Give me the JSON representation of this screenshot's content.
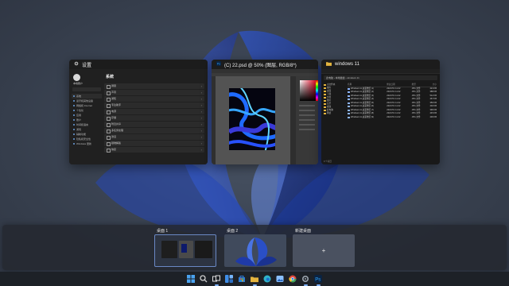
{
  "windows": [
    {
      "id": "settings",
      "title": "设置",
      "icon": "gear-icon"
    },
    {
      "id": "photoshop",
      "title": "(C) 22.psd @ 50% (图层, RGB/8*)",
      "icon": "photoshop-icon"
    },
    {
      "id": "explorer",
      "title": "windows 11",
      "icon": "folder-icon"
    }
  ],
  "settings": {
    "heading": "系统",
    "user": "本地账户",
    "nav": [
      "系统",
      "蓝牙和其他设备",
      "网络和 Internet",
      "个性化",
      "应用",
      "账户",
      "时间和语言",
      "游戏",
      "辅助功能",
      "隐私和安全性",
      "Windows 更新"
    ],
    "rows": [
      "屏幕",
      "声音",
      "通知",
      "专注助手",
      "电源",
      "存储",
      "附近共享",
      "多任务处理",
      "激活",
      "疑难解答",
      "恢复"
    ]
  },
  "explorer": {
    "address": "此电脑 › 本地磁盘 › windows 11",
    "nav": [
      "主文件夹",
      "图库",
      "桌面",
      "下载",
      "文档",
      "图片",
      "音乐",
      "视频",
      "此电脑",
      "网络"
    ],
    "columns": [
      "名称",
      "修改日期",
      "类型",
      "大小"
    ],
    "files": [
      {
        "name": "Windows 11 桌面壁纸 (1)",
        "date": "2021/7/1 11:22",
        "type": "JPG 文件",
        "size": "421 KB"
      },
      {
        "name": "Windows 11 桌面壁纸 (2)",
        "date": "2021/7/1 11:22",
        "type": "JPG 文件",
        "size": "388 KB"
      },
      {
        "name": "Windows 11 桌面壁纸 (3)",
        "date": "2021/7/1 11:22",
        "type": "JPG 文件",
        "size": "512 KB"
      },
      {
        "name": "Windows 11 桌面壁纸 (4)",
        "date": "2021/7/1 11:22",
        "type": "JPG 文件",
        "size": "467 KB"
      },
      {
        "name": "Windows 11 桌面壁纸 (5)",
        "date": "2021/7/1 11:22",
        "type": "JPG 文件",
        "size": "350 KB"
      },
      {
        "name": "Windows 11 桌面壁纸 (6)",
        "date": "2021/7/1 11:22",
        "type": "JPG 文件",
        "size": "402 KB"
      },
      {
        "name": "Windows 11 桌面壁纸 (7)",
        "date": "2021/7/1 11:22",
        "type": "JPG 文件",
        "size": "396 KB"
      },
      {
        "name": "Windows 11 桌面壁纸 (8)",
        "date": "2021/7/1 11:22",
        "type": "JPG 文件",
        "size": "445 KB"
      },
      {
        "name": "Windows 11 桌面壁纸 (9)",
        "date": "2021/7/1 11:22",
        "type": "JPG 文件",
        "size": "430 KB"
      }
    ],
    "status": "9 个项目"
  },
  "desktops": [
    {
      "label": "桌面 1",
      "active": true
    },
    {
      "label": "桌面 2",
      "active": false
    }
  ],
  "new_desktop": {
    "label": "新建桌面",
    "icon": "plus-icon",
    "symbol": "+"
  },
  "taskbar": [
    {
      "name": "start-icon",
      "color": "#4aa3f0",
      "active": false
    },
    {
      "name": "search-icon",
      "color": "#d0d0d0",
      "active": false
    },
    {
      "name": "task-view-icon",
      "color": "#e0e0e0",
      "active": true
    },
    {
      "name": "widgets-icon",
      "color": "#3f8ee8",
      "active": false
    },
    {
      "name": "store-icon",
      "color": "#2d7bd6",
      "active": false
    },
    {
      "name": "file-explorer-icon",
      "color": "#e4b43e",
      "active": true
    },
    {
      "name": "edge-icon",
      "color": "#2fb3c9",
      "active": false
    },
    {
      "name": "photos-icon",
      "color": "#8ac0ff",
      "active": false
    },
    {
      "name": "chrome-icon",
      "color": "#e0493d",
      "active": false
    },
    {
      "name": "settings-icon",
      "color": "#9aa3ad",
      "active": true
    },
    {
      "name": "photoshop-icon",
      "color": "#2f79c8",
      "active": true
    }
  ],
  "colors": {
    "accent": "#7fb2ff",
    "panel": "#202020",
    "wallpaper": "#3b4453"
  }
}
